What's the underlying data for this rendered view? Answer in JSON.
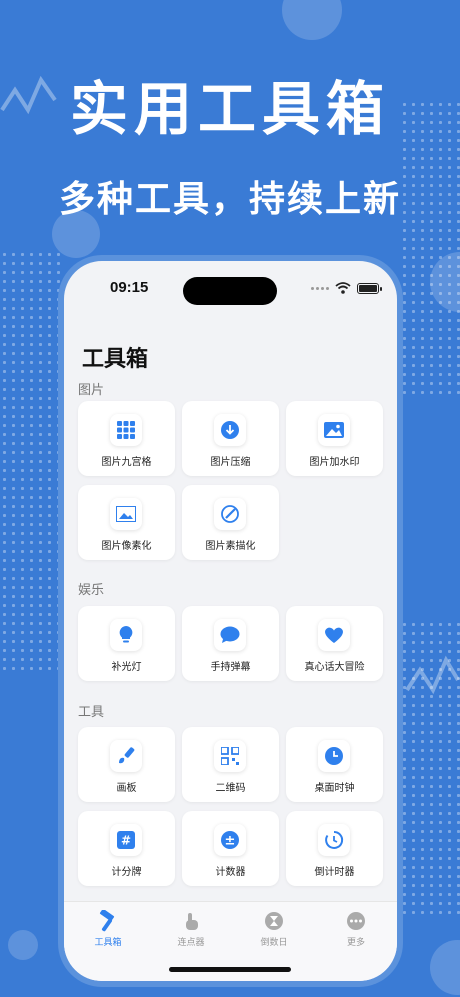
{
  "hero": {
    "title": "实用工具箱",
    "subtitle": "多种工具，持续上新"
  },
  "status": {
    "time": "09:15"
  },
  "page_title": "工具箱",
  "sections": [
    {
      "label": "图片",
      "items": [
        {
          "label": "图片九宫格",
          "icon": "grid-icon"
        },
        {
          "label": "图片压缩",
          "icon": "compress-icon"
        },
        {
          "label": "图片加水印",
          "icon": "image-icon"
        },
        {
          "label": "图片像素化",
          "icon": "pixel-image-icon"
        },
        {
          "label": "图片素描化",
          "icon": "sketch-icon"
        }
      ]
    },
    {
      "label": "娱乐",
      "items": [
        {
          "label": "补光灯",
          "icon": "bulb-icon"
        },
        {
          "label": "手持弹幕",
          "icon": "chat-bubble-icon"
        },
        {
          "label": "真心话大冒险",
          "icon": "heart-icon"
        }
      ]
    },
    {
      "label": "工具",
      "items": [
        {
          "label": "画板",
          "icon": "brush-icon"
        },
        {
          "label": "二维码",
          "icon": "qrcode-icon"
        },
        {
          "label": "桌面时钟",
          "icon": "clock-icon"
        },
        {
          "label": "计分牌",
          "icon": "hash-icon"
        },
        {
          "label": "计数器",
          "icon": "plus-minus-icon"
        },
        {
          "label": "倒计时器",
          "icon": "timer-icon"
        }
      ]
    }
  ],
  "tabs": [
    {
      "label": "工具箱",
      "icon": "hammer-icon",
      "active": true
    },
    {
      "label": "连点器",
      "icon": "tap-icon",
      "active": false
    },
    {
      "label": "倒数日",
      "icon": "hourglass-icon",
      "active": false
    },
    {
      "label": "更多",
      "icon": "more-icon",
      "active": false
    }
  ],
  "colors": {
    "accent": "#2f80ed",
    "background": "#3a7bd5"
  }
}
